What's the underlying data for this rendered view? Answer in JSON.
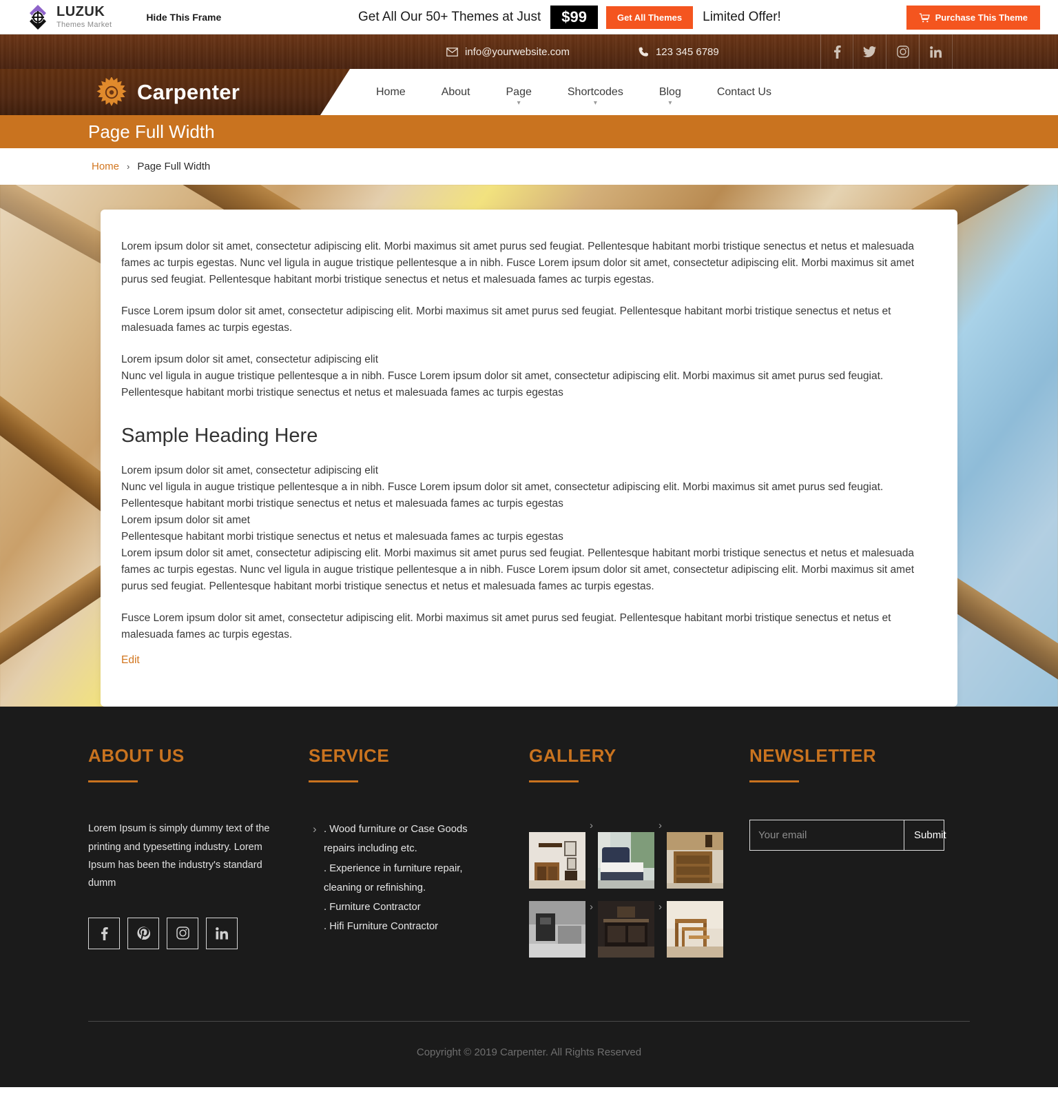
{
  "promo": {
    "logo_title": "LUZUK",
    "logo_subtitle": "Themes Market",
    "hide_frame_label": "Hide This Frame",
    "offer_text": "Get All Our 50+ Themes at Just",
    "price": "$99",
    "get_all_themes_label": "Get All Themes",
    "limited_offer_label": "Limited Offer!",
    "purchase_label": "Purchase This Theme",
    "accent_color": "#f4551f"
  },
  "header": {
    "email": "info@yourwebsite.com",
    "phone": "123 345 6789",
    "social": [
      "facebook-icon",
      "twitter-icon",
      "instagram-icon",
      "linkedin-icon"
    ],
    "brand_name": "Carpenter",
    "nav": [
      {
        "label": "Home",
        "has_dropdown": false
      },
      {
        "label": "About",
        "has_dropdown": false
      },
      {
        "label": "Page",
        "has_dropdown": true
      },
      {
        "label": "Shortcodes",
        "has_dropdown": true
      },
      {
        "label": "Blog",
        "has_dropdown": true
      },
      {
        "label": "Contact Us",
        "has_dropdown": false
      }
    ]
  },
  "page": {
    "title": "Page Full Width",
    "breadcrumb_home": "Home",
    "breadcrumb_sep": "›",
    "breadcrumb_current": "Page Full Width",
    "title_bar_color": "#c9731f"
  },
  "content": {
    "p1": "Lorem ipsum dolor sit amet, consectetur adipiscing elit. Morbi maximus sit amet purus sed feugiat. Pellentesque habitant morbi tristique senectus et netus et malesuada fames ac turpis egestas. Nunc vel ligula in augue tristique pellentesque a in nibh. Fusce Lorem ipsum dolor sit amet, consectetur adipiscing elit. Morbi maximus sit amet purus sed feugiat. Pellentesque habitant morbi tristique senectus et netus et malesuada fames ac turpis egestas.",
    "p2": "Fusce Lorem ipsum dolor sit amet, consectetur adipiscing elit. Morbi maximus sit amet purus sed feugiat. Pellentesque habitant morbi tristique senectus et netus et malesuada fames ac turpis egestas.",
    "p3": "Lorem ipsum dolor sit amet, consectetur adipiscing elit",
    "p4": "Nunc vel ligula in augue tristique pellentesque a in nibh. Fusce Lorem ipsum dolor sit amet, consectetur adipiscing elit. Morbi maximus sit amet purus sed feugiat. Pellentesque habitant morbi tristique senectus et netus et malesuada fames ac turpis egestas",
    "heading": "Sample Heading Here",
    "p5": "Lorem ipsum dolor sit amet, consectetur adipiscing elit",
    "p6": "Nunc vel ligula in augue tristique pellentesque a in nibh. Fusce Lorem ipsum dolor sit amet, consectetur adipiscing elit. Morbi maximus sit amet purus sed feugiat. Pellentesque habitant morbi tristique senectus et netus et malesuada fames ac turpis egestas",
    "p7": "Lorem ipsum dolor sit amet",
    "p8": "Pellentesque habitant morbi tristique senectus et netus et malesuada fames ac turpis egestas",
    "p9": "Lorem ipsum dolor sit amet, consectetur adipiscing elit. Morbi maximus sit amet purus sed feugiat. Pellentesque habitant morbi tristique senectus et netus et malesuada fames ac turpis egestas. Nunc vel ligula in augue tristique pellentesque a in nibh. Fusce Lorem ipsum dolor sit amet, consectetur adipiscing elit. Morbi maximus sit amet purus sed feugiat. Pellentesque habitant morbi tristique senectus et netus et malesuada fames ac turpis egestas.",
    "p10": "Fusce Lorem ipsum dolor sit amet, consectetur adipiscing elit. Morbi maximus sit amet purus sed feugiat. Pellentesque habitant morbi tristique senectus et netus et malesuada fames ac turpis egestas.",
    "edit_label": "Edit"
  },
  "footer": {
    "about": {
      "heading": "ABOUT US",
      "text": "Lorem Ipsum is simply dummy text of the printing and typesetting industry. Lorem Ipsum has been the industry's standard dumm",
      "socials": [
        "facebook-icon",
        "pinterest-icon",
        "instagram-icon",
        "linkedin-icon"
      ]
    },
    "service": {
      "heading": "SERVICE",
      "items": [
        ". Wood furniture or Case Goods",
        "repairs including etc.",
        ". Experience in furniture repair,",
        "cleaning or refinishing.",
        ". Furniture Contractor",
        ". Hifi Furniture Contractor"
      ]
    },
    "gallery": {
      "heading": "GALLERY",
      "thumbs": [
        "wine-cabinet-thumb",
        "blue-bed-thumb",
        "wood-dresser-thumb",
        "grey-bedroom-thumb",
        "dark-sideboard-thumb",
        "nesting-tables-thumb"
      ]
    },
    "newsletter": {
      "heading": "NEWSLETTER",
      "placeholder": "Your email",
      "value": "",
      "submit_label": "Submit"
    },
    "copyright": "Copyright © 2019 Carpenter. All Rights Reserved",
    "heading_color": "#c9731f",
    "bg_color": "#1b1b1b"
  }
}
